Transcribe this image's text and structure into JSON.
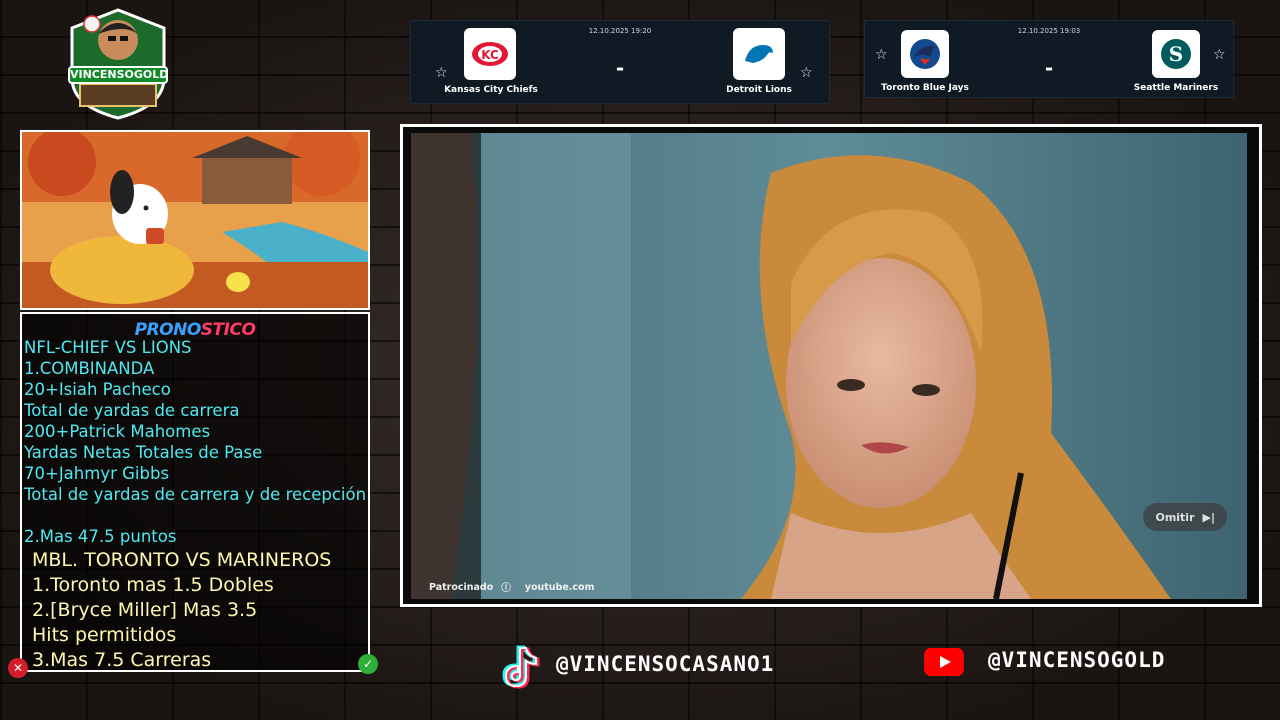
{
  "logo": {
    "text": "VINCENSOGOLD"
  },
  "scoreboards": [
    {
      "date": "12.10.2025 19:20",
      "score": "-",
      "home": "Kansas City Chiefs",
      "away": "Detroit Lions"
    },
    {
      "date": "12.10.2025 19:03",
      "score": "-",
      "home": "Toronto Blue Jays",
      "away": "Seattle Mariners"
    }
  ],
  "pick": {
    "title_a": "PRONO",
    "title_b": "STICO",
    "nfl_lines": [
      "NFL-CHIEF VS LIONS",
      "1.COMBINANDA",
      "20+Isiah Pacheco",
      "Total de yardas de carrera",
      "200+Patrick Mahomes",
      "Yardas Netas Totales de Pase",
      "70+Jahmyr Gibbs",
      "Total de yardas de carrera y de recepción",
      "",
      "2.Mas 47.5 puntos"
    ],
    "mlb_lines": [
      "MBL. TORONTO VS MARINEROS",
      "1.Toronto mas 1.5 Dobles",
      "2.[Bryce Miller] Mas 3.5",
      "Hits permitidos",
      "3.Mas 7.5 Carreras"
    ]
  },
  "video": {
    "skip_label": "Omitir",
    "sponsored_label": "Patrocinado",
    "source": "youtube.com"
  },
  "socials": {
    "tiktok": "@VINCENSOCASANO1",
    "youtube": "@VINCENSOGOLD"
  },
  "colors": {
    "nfl_text": "#4fe9f2",
    "mlb_text": "#fff6b0",
    "card_bg": "#0f1a24"
  }
}
